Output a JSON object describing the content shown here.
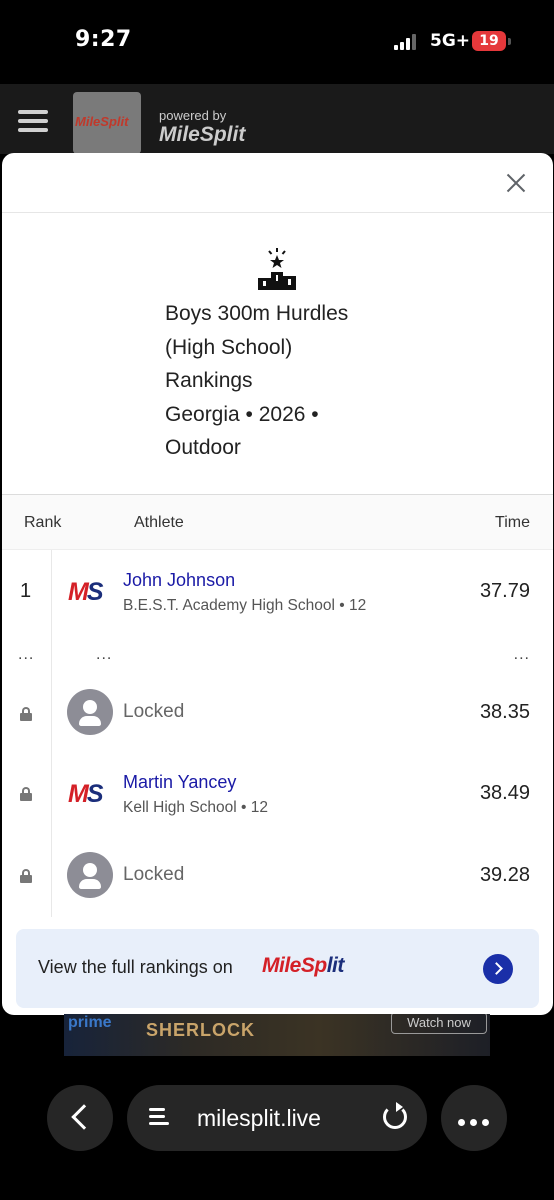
{
  "status_bar": {
    "time": "9:27",
    "network": "5G+",
    "battery": "19",
    "battery_color": "#e5383b"
  },
  "header": {
    "logo_text": "MileSplit",
    "powered_by": "powered by",
    "powered_logo": "MileSplit"
  },
  "modal": {
    "icon": "podium-icon",
    "title_lines": [
      "Boys 300m Hurdles",
      "(High School)",
      "Rankings",
      "Georgia • 2026 •",
      "Outdoor"
    ],
    "columns": {
      "rank": "Rank",
      "athlete": "Athlete",
      "time": "Time"
    },
    "rows": [
      {
        "rank": "1",
        "name": "John Johnson",
        "school": "B.E.S.T. Academy High School • 12",
        "time": "37.79",
        "locked": false
      },
      {
        "rank": "...",
        "name": "...",
        "time": "..."
      },
      {
        "name": "Locked",
        "time": "38.35",
        "locked": true
      },
      {
        "name": "Martin Yancey",
        "school": "Kell High School • 12",
        "time": "38.49",
        "locked": true
      },
      {
        "name": "Locked",
        "time": "39.28",
        "locked": true
      }
    ],
    "team_logo": {
      "m": "M",
      "s": "S"
    },
    "cta": {
      "text": "View the full rankings on",
      "logo_part1": "MileSp",
      "logo_part2": "lit"
    },
    "accent": "#1a1aa6"
  },
  "ad": {
    "prime": "prime",
    "title": "SHERLOCK",
    "button": "Watch now"
  },
  "bottom_bar": {
    "url": "milesplit.live"
  }
}
